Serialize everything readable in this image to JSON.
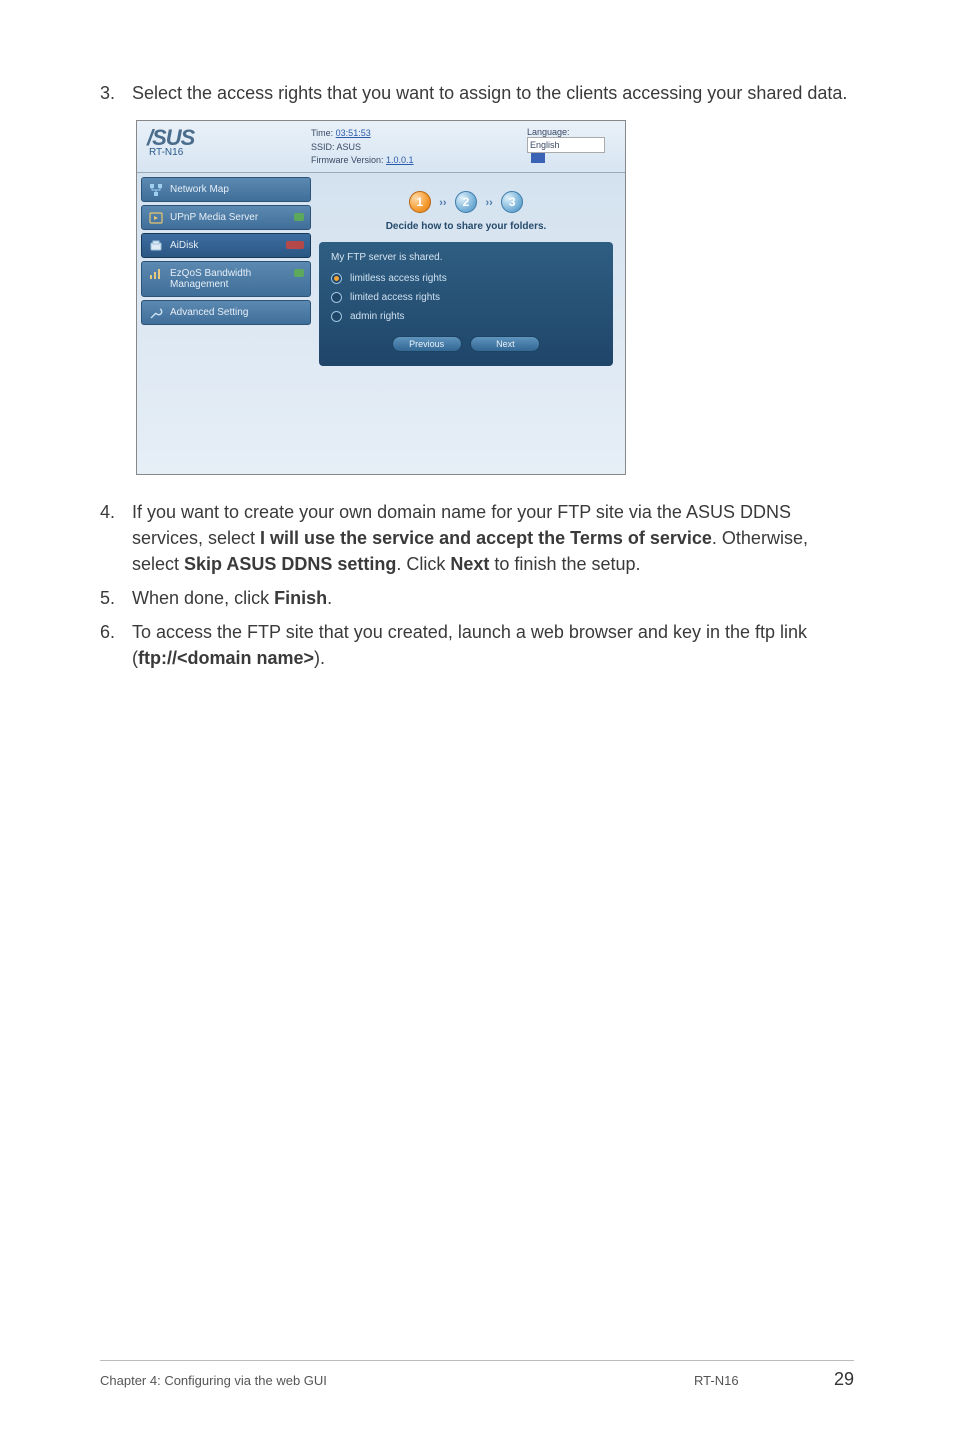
{
  "steps": {
    "s3": {
      "num": "3.",
      "text": "Select the access rights that you want to assign to the clients accessing your shared data."
    },
    "s4": {
      "num": "4.",
      "t1": "If you want to create your own domain name for your FTP site via the ASUS DDNS services, select ",
      "b1": "I will use the service and accept the Terms of service",
      "t2": ". Otherwise, select ",
      "b2": "Skip ASUS DDNS setting",
      "t3": ". Click ",
      "b3": "Next",
      "t4": " to finish the setup."
    },
    "s5": {
      "num": "5.",
      "t1": "When done, click ",
      "b1": "Finish",
      "t2": "."
    },
    "s6": {
      "num": "6.",
      "t1": "To access the FTP site that you created, launch a web browser and key in the ftp link (",
      "b1": "ftp://<domain name>",
      "t2": ")."
    }
  },
  "router": {
    "brand": "/SUS",
    "model": "RT-N16",
    "header": {
      "time_label": "Time: ",
      "time_value": "03:51:53",
      "ssid_label": "SSID: ",
      "ssid_value": "ASUS",
      "fw_label": "Firmware Version: ",
      "fw_value": "1.0.0.1",
      "lang_label": "Language:",
      "lang_value": "English"
    },
    "sidebar": {
      "items": [
        {
          "label": "Network Map"
        },
        {
          "label": "UPnP Media Server"
        },
        {
          "label": "AiDisk"
        },
        {
          "label": "EzQoS Bandwidth Management"
        },
        {
          "label": "Advanced Setting"
        }
      ]
    },
    "wizard": {
      "step_labels": [
        "1",
        "2",
        "3"
      ],
      "title": "Decide how to share your folders.",
      "shared_label": "My FTP server is shared.",
      "options": [
        "limitless access rights",
        "limited access rights",
        "admin rights"
      ],
      "prev": "Previous",
      "next": "Next"
    }
  },
  "footer": {
    "left": "Chapter 4: Configuring via the web GUI",
    "mid": "RT-N16",
    "page": "29"
  }
}
